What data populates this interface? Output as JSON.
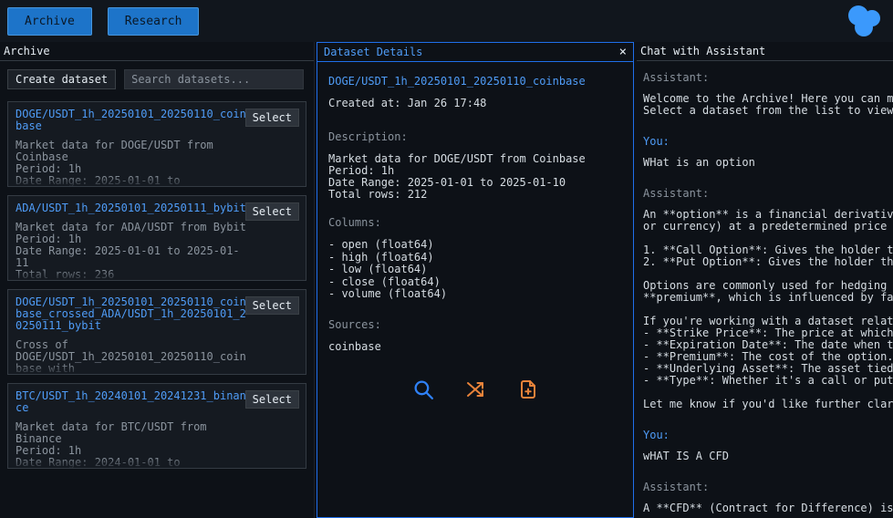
{
  "theme": {
    "accent_blue": "#1f6feb",
    "link_blue": "#4f9cf7",
    "orange": "#e8833a",
    "text_muted": "#8b949e"
  },
  "topbar": {
    "buttons": [
      {
        "label": "Archive"
      },
      {
        "label": "Research"
      }
    ]
  },
  "archive": {
    "title": "Archive",
    "create_button": "Create dataset",
    "search_placeholder": "Search datasets...",
    "datasets": [
      {
        "name": "DOGE/USDT_1h_20250101_20250110_coinbase",
        "select": "Select",
        "description": "Market data for DOGE/USDT from Coinbase\nPeriod: 1h\nDate Range: 2025-01-01 to"
      },
      {
        "name": "ADA/USDT_1h_20250101_20250111_bybit",
        "select": "Select",
        "description": "Market data for ADA/USDT from Bybit\nPeriod: 1h\nDate Range: 2025-01-01 to 2025-01-11\nTotal rows: 236"
      },
      {
        "name": "DOGE/USDT_1h_20250101_20250110_coinbase_crossed_ADA/USDT_1h_20250101_20250111_bybit",
        "select": "Select",
        "description": "Cross of DOGE/USDT_1h_20250101_20250110_coinbase with"
      },
      {
        "name": "BTC/USDT_1h_20240101_20241231_binance",
        "select": "Select",
        "description": "Market data for BTC/USDT from Binance\nPeriod: 1h\nDate Range: 2024-01-01 to"
      }
    ]
  },
  "details": {
    "title": "Dataset Details",
    "close": "×",
    "name": "DOGE/USDT_1h_20250101_20250110_coinbase",
    "created": "Created at: Jan 26 17:48",
    "description_label": "Description:",
    "description": "Market data for DOGE/USDT from Coinbase\nPeriod: 1h\nDate Range: 2025-01-01 to 2025-01-10\nTotal rows: 212",
    "columns_label": "Columns:",
    "columns": "- open (float64)\n- high (float64)\n- low (float64)\n- close (float64)\n- volume (float64)",
    "sources_label": "Sources:",
    "sources": "coinbase"
  },
  "chat": {
    "title": "Chat with Assistant",
    "messages": [
      {
        "role": "Assistant:",
        "text": "Welcome to the Archive! Here you can ma\nSelect a dataset from the list to view"
      },
      {
        "role": "You:",
        "text": "WHat is an option"
      },
      {
        "role": "Assistant:",
        "text": "An **option** is a financial derivative\nor currency) at a predetermined price (\n\n1. **Call Option**: Gives the holder th\n2. **Put Option**: Gives the holder the\n\nOptions are commonly used for hedging (\n**premium**, which is influenced by fac\n\nIf you're working with a dataset relate\n- **Strike Price**: The price at which\n- **Expiration Date**: The date when th\n- **Premium**: The cost of the option.\n- **Underlying Asset**: The asset tied\n- **Type**: Whether it's a call or put\n\nLet me know if you'd like further clari"
      },
      {
        "role": "You:",
        "text": "wHAT IS A CFD"
      },
      {
        "role": "Assistant:",
        "text": "A **CFD** (Contract for Difference) is"
      }
    ]
  }
}
